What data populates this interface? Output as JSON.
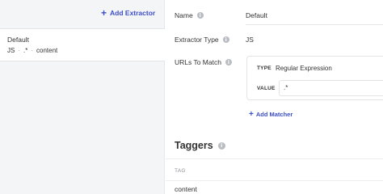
{
  "sidebar": {
    "add_extractor_label": "Add Extractor",
    "extractors": [
      {
        "name": "Default",
        "type": "JS",
        "pattern": ".*",
        "target": "content"
      }
    ]
  },
  "form": {
    "name_label": "Name",
    "name_value": "Default",
    "type_label": "Extractor Type",
    "type_value": "JS",
    "urls_label": "URLs To Match",
    "matcher": {
      "type_label": "TYPE",
      "type_value": "Regular Expression",
      "value_label": "VALUE",
      "value_value": ".*"
    },
    "add_matcher_label": "Add Matcher"
  },
  "taggers": {
    "title": "Taggers",
    "column_header": "TAG",
    "rows": [
      "content"
    ]
  },
  "colors": {
    "accent": "#3b4ec7",
    "sidebar_bg": "#f4f5f6"
  }
}
